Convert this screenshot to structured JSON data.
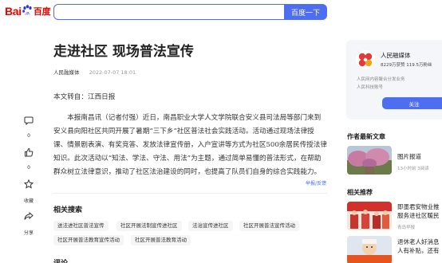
{
  "header": {
    "logo_text": "Bai",
    "logo_du": "百度",
    "search_value": "",
    "search_button": "百度一下"
  },
  "article": {
    "title": "走进社区 现场普法宣传",
    "author": "人民融媒体",
    "date": "2022-07-07 18:01",
    "source": "本文转自：江西日报",
    "paragraph": "本报南昌讯（记者付强）近日，南昌职业大学人文学院联合安义县司法局等部门来到安义县向阳社区共同开展了暑期“三下乡”社区普法社会实践活动。活动通过现场法律授课、情景剧表演、有奖竞答、发放法律宣传册，入户宣讲等方式为社区500余居民传授法律知识。此次活动以“知法、学法、守法、用法”为主题，通过简单易懂的普法形式，在帮助群众树立法律意识，推动了社区法治建设的同时，也提高了队员们自身的综合实践能力。",
    "report_label": "举报/反馈"
  },
  "actions": {
    "comment_count": "0",
    "like_count": "0",
    "favorite_label": "收藏",
    "share_label": "分享"
  },
  "related_search": {
    "title": "相关搜索",
    "tags": [
      "送法进社区普法宣传",
      "社区开展法制宣传进社区",
      "法治宣传进社区",
      "社区开展普法宣传活动",
      "社区开展普法教育宣传活动",
      "社区开展普法教育活动"
    ]
  },
  "comments": {
    "title": "评论"
  },
  "author_panel": {
    "name": "人民融媒体",
    "stats": "8229万获赞 119.5万粉丝",
    "desc_line1": "人民网内容聚合分发业务",
    "desc_line2": "人民科技账号",
    "follow_label": "关注"
  },
  "latest": {
    "title": "作者最新文章",
    "items": [
      {
        "title": "图片报道",
        "meta": "13小时前 3阅读"
      }
    ]
  },
  "recommend": {
    "title": "相关推荐",
    "items": [
      {
        "title_line1": "即墨君安物业推",
        "title_line2": "服务进社区暖民",
        "source": "青岛早报"
      },
      {
        "title_line1": "退休老人好消息",
        "title_line2": "人有补贴，还有",
        "source": ""
      }
    ]
  },
  "colors": {
    "accent": "#4e6ef2",
    "logo_red": "#e10601",
    "logo_blue": "#2932e1"
  }
}
